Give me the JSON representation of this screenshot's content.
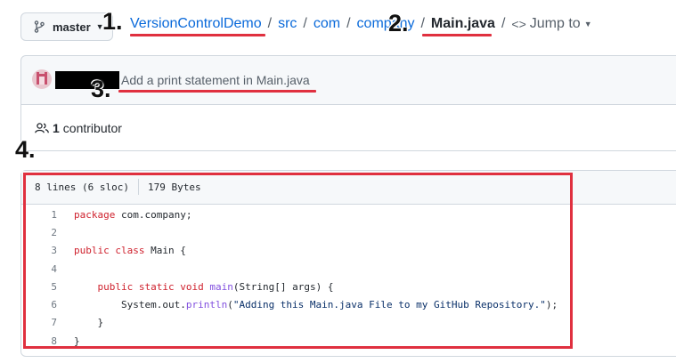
{
  "branch": {
    "name": "master"
  },
  "breadcrumb": {
    "repo": "VersionControlDemo",
    "path": [
      "src",
      "com",
      "company"
    ],
    "file": "Main.java",
    "jump_to": "Jump to"
  },
  "commit": {
    "message": "Add a print statement in Main.java"
  },
  "contributors": {
    "count": "1",
    "label": "contributor"
  },
  "file_info": {
    "lines": "8 lines (6 sloc)",
    "size": "179 Bytes"
  },
  "code": {
    "line_numbers": [
      "1",
      "2",
      "3",
      "4",
      "5",
      "6",
      "7",
      "8"
    ],
    "lines": [
      "package com.company;",
      "",
      "public class Main {",
      "",
      "    public static void main(String[] args) {",
      "        System.out.println(\"Adding this Main.java File to my GitHub Repository.\");",
      "    }",
      "}"
    ]
  },
  "annotations": {
    "n1": "1.",
    "n2": "2.",
    "n3": "3.",
    "n4": "4."
  },
  "colors": {
    "highlight": "#e0303f",
    "link": "#0969da"
  }
}
